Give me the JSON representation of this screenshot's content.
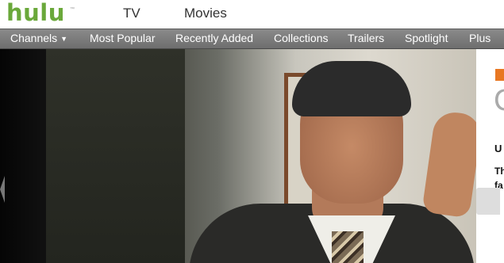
{
  "brand": {
    "logo": "hulu",
    "logo_color": "#6aa83a",
    "tm": "™"
  },
  "top_nav": {
    "tv": "TV",
    "movies": "Movies"
  },
  "nav": {
    "items": [
      {
        "label": "Channels",
        "has_dropdown": true,
        "icon": "chevron-down-icon"
      },
      {
        "label": "Most Popular"
      },
      {
        "label": "Recently Added"
      },
      {
        "label": "Collections"
      },
      {
        "label": "Trailers"
      },
      {
        "label": "Spotlight"
      },
      {
        "label": "Plus"
      }
    ],
    "dropdown_glyph": "▼"
  },
  "hero": {
    "left_arrow_icon": "chevron-left-icon",
    "panel": {
      "accent_color": "#e87722",
      "big_text": "C",
      "line1": "U",
      "line2": "Th",
      "line3": "fa"
    }
  }
}
